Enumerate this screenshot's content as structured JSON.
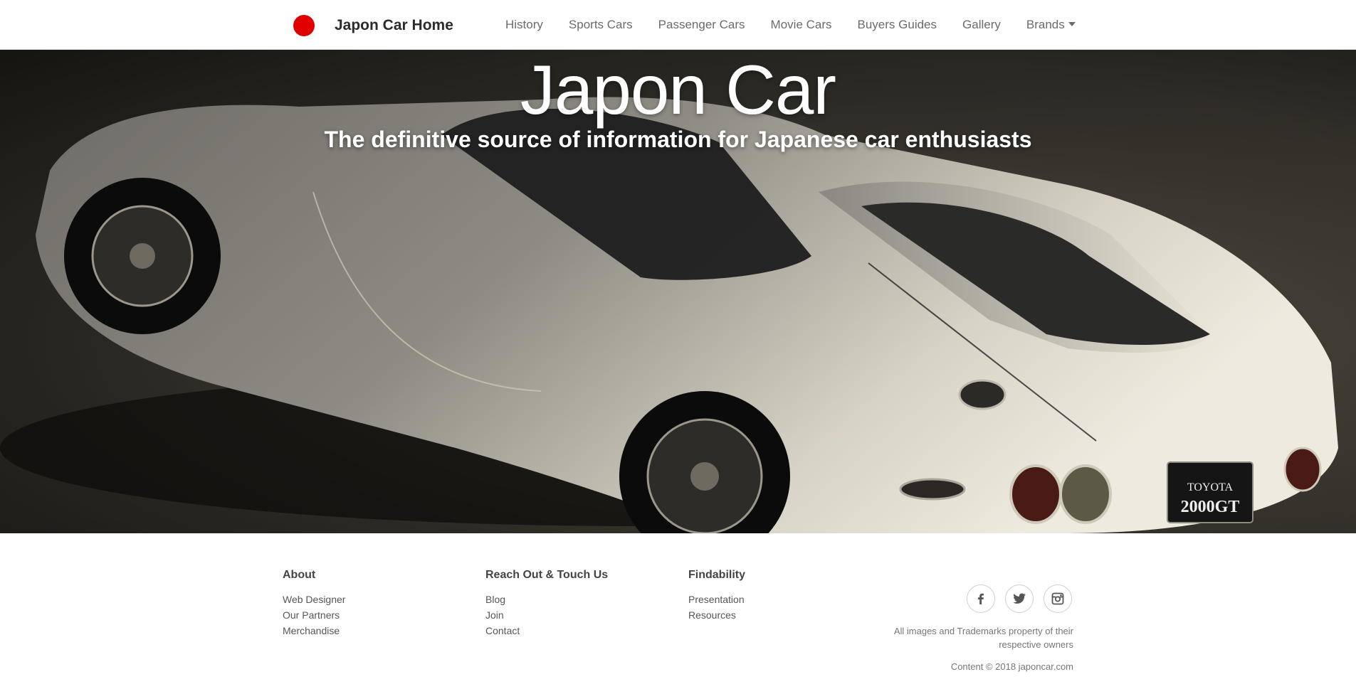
{
  "brand": {
    "name": "Japon Car Home",
    "logo_color": "#e00000"
  },
  "nav": {
    "items": [
      {
        "label": "History"
      },
      {
        "label": "Sports Cars"
      },
      {
        "label": "Passenger Cars"
      },
      {
        "label": "Movie Cars"
      },
      {
        "label": "Buyers Guides"
      },
      {
        "label": "Gallery"
      },
      {
        "label": "Brands",
        "has_dropdown": true
      }
    ]
  },
  "hero": {
    "title": "Japon Car",
    "subtitle": "The definitive source of information for Japanese car enthusiasts",
    "image_plate": {
      "line1": "TOYOTA",
      "line2": "2000GT"
    }
  },
  "footer": {
    "columns": [
      {
        "heading": "About",
        "links": [
          "Web Designer",
          "Our Partners",
          "Merchandise"
        ]
      },
      {
        "heading": "Reach Out & Touch Us",
        "links": [
          "Blog",
          "Join",
          "Contact"
        ]
      },
      {
        "heading": "Findability",
        "links": [
          "Presentation",
          "Resources"
        ]
      }
    ],
    "social": [
      {
        "name": "facebook-icon"
      },
      {
        "name": "twitter-icon"
      },
      {
        "name": "instagram-icon"
      }
    ],
    "rights_text": "All images and Trademarks property of their respective owners",
    "copyright": "Content © 2018 japoncar.com"
  }
}
